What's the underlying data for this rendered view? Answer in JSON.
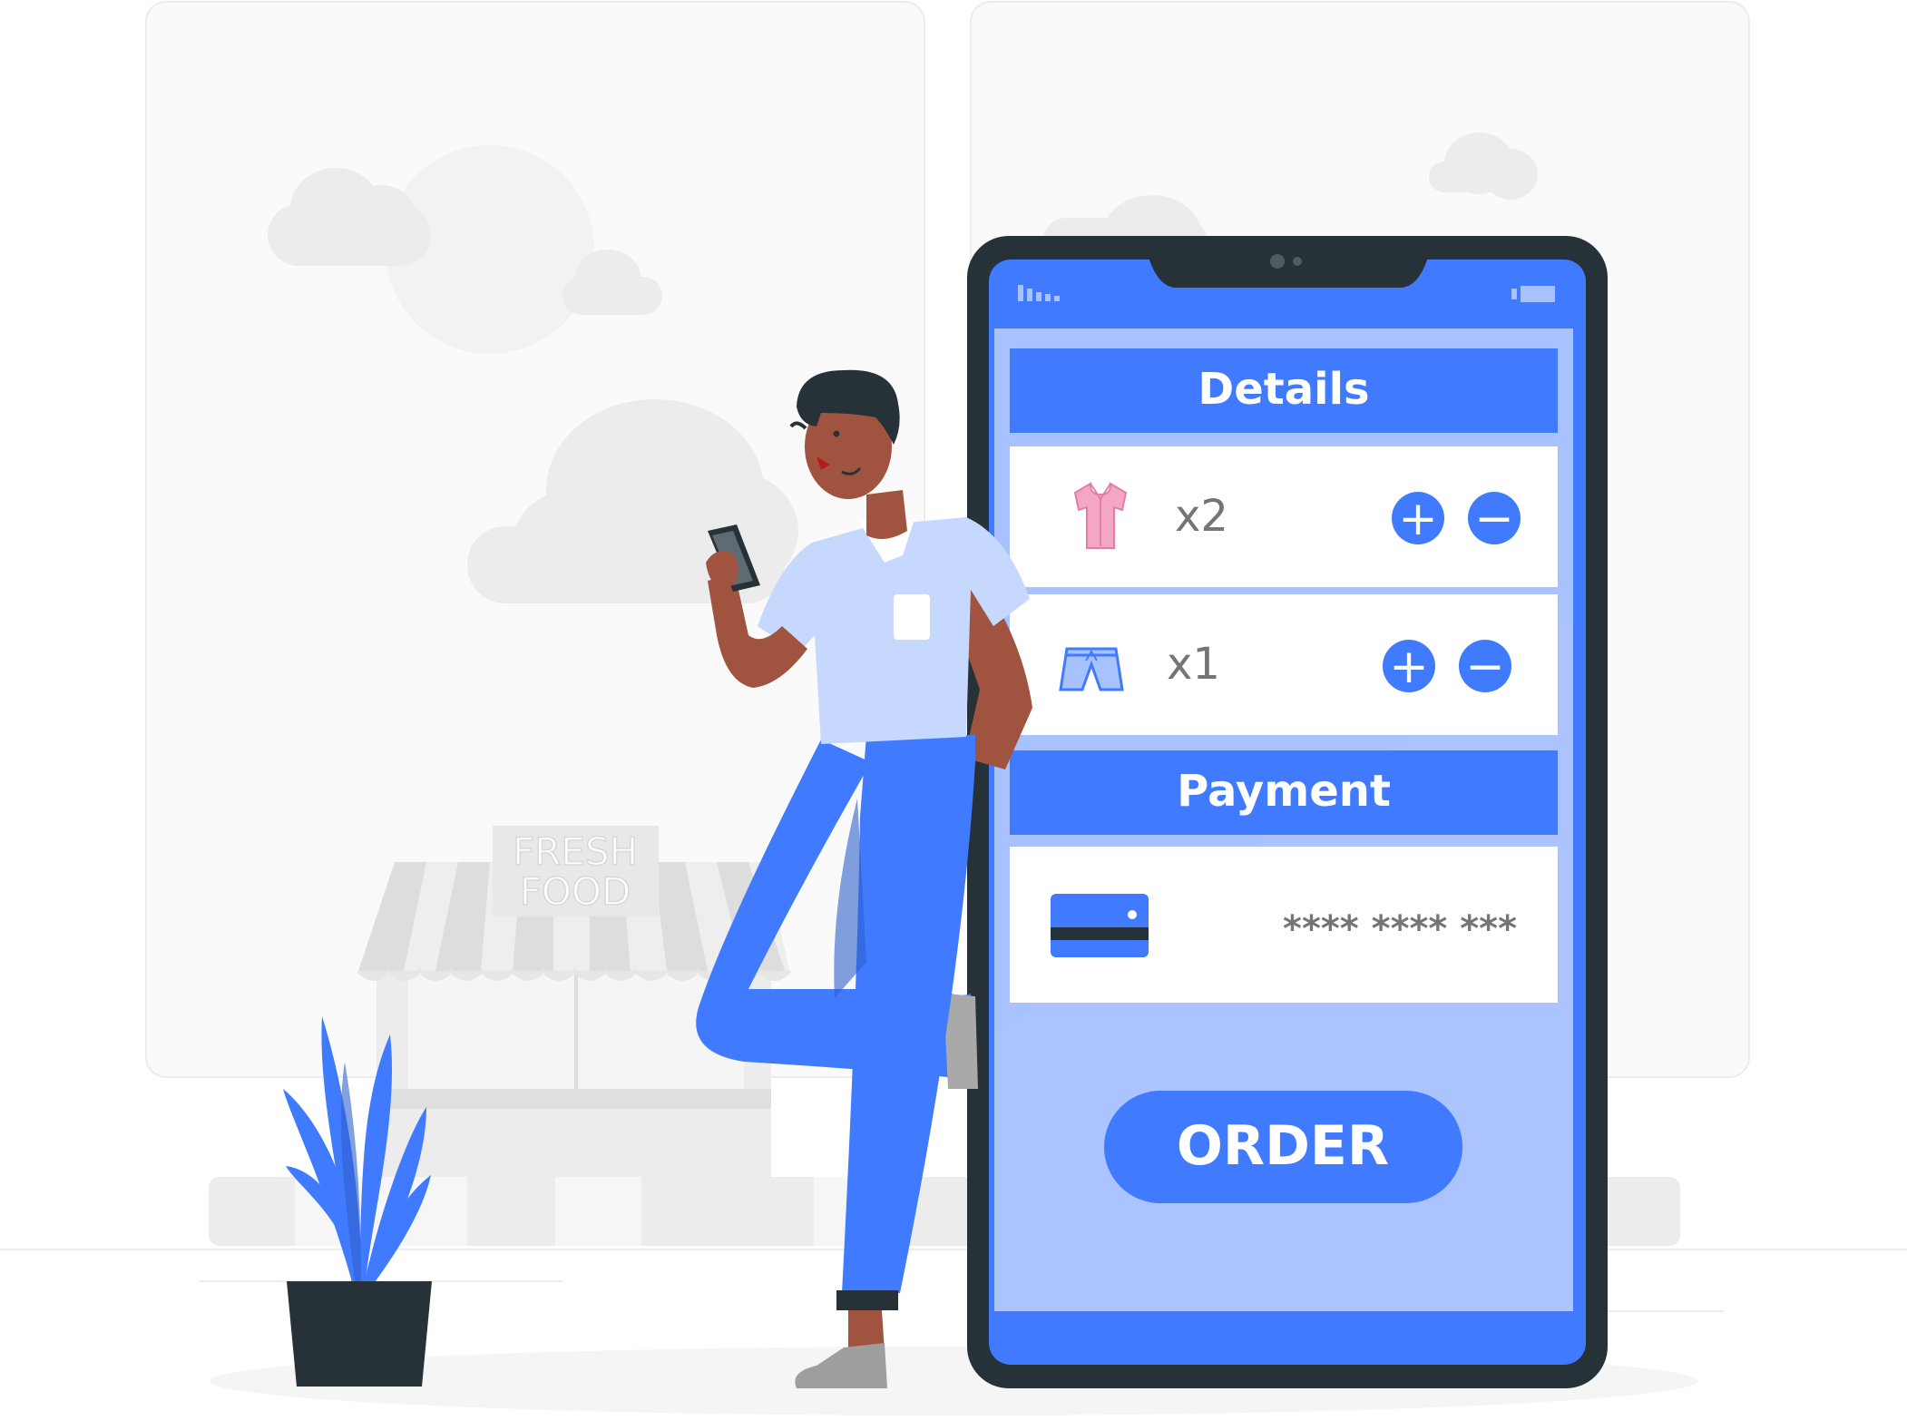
{
  "store_sign": {
    "line1": "FRESH",
    "line2": "FOOD"
  },
  "phone": {
    "details_header": "Details",
    "items": [
      {
        "name": "shirt",
        "quantity_label": "x2",
        "plus_label": "+",
        "minus_label": "−"
      },
      {
        "name": "shorts",
        "quantity_label": "x1",
        "plus_label": "+",
        "minus_label": "−"
      }
    ],
    "payment_header": "Payment",
    "card_number_masked": "**** **** ***",
    "order_label": "ORDER"
  },
  "colors": {
    "accent": "#407BFF",
    "accent_light": "#A8C1FF",
    "phone_frame": "#263238",
    "grey_bg": "#F5F5F5",
    "text_grey": "#757575"
  }
}
